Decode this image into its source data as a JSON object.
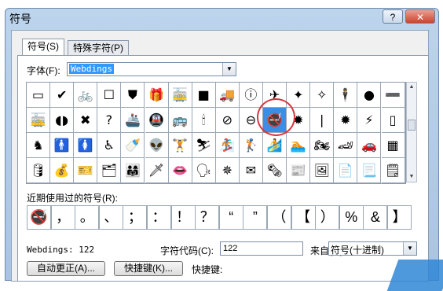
{
  "dialog": {
    "title": "符号",
    "help": "?",
    "close": "✕"
  },
  "tabs": [
    {
      "label": "符号(S)"
    },
    {
      "label": "特殊字符(P)"
    }
  ],
  "font": {
    "label": "字体(F):",
    "value": "Webdings"
  },
  "grid": {
    "rows": [
      [
        "▭",
        "✔",
        "🚲",
        "☐",
        "⛊",
        "🎁",
        "🚋",
        "■",
        "🚚",
        "ⓘ",
        "✈",
        "✦",
        "✧",
        "🕴",
        "●",
        "➖"
      ],
      [
        "🚋",
        "◖◗",
        "✖",
        "?",
        "🚢",
        "🚇",
        "🚌",
        "🕯",
        "⊘",
        "⊖",
        "🚭",
        "✹",
        "❘",
        "✹",
        "⚡",
        "▯"
      ],
      [
        "♞",
        "🚹",
        "🚺",
        "♿",
        "🍼",
        "👽",
        "🏋",
        "⛷",
        "🏂",
        "🏌",
        "🏄",
        "🏊",
        "🏍",
        "🏎",
        "🚗",
        "▦"
      ],
      [
        "🛢",
        "💰",
        "🎫",
        "🗂",
        "👨‍👩‍👧",
        "🗡",
        "👄",
        "🗣",
        "✵",
        "✉",
        "🗞",
        "📰",
        "🖼",
        "📄",
        "📃",
        "🗒"
      ]
    ],
    "selected_row": 1,
    "selected_col": 10
  },
  "recent": {
    "label": "近期使用过的符号(R):",
    "symbols": [
      "🚭",
      "，",
      "。",
      "、",
      "；",
      "：",
      "！",
      "？",
      "“",
      "”",
      "（",
      "【",
      "）",
      "%",
      "&",
      "】"
    ]
  },
  "info": {
    "description": "Webdings: 122",
    "code_label": "字符代码(C):",
    "code_value": "122",
    "from_label": "来自(M):",
    "from_value": "符号(十进制)"
  },
  "buttons": {
    "autocorrect": "自动更正(A)...",
    "shortcut": "快捷键(K)...",
    "shortcut_label": "快捷键:"
  }
}
